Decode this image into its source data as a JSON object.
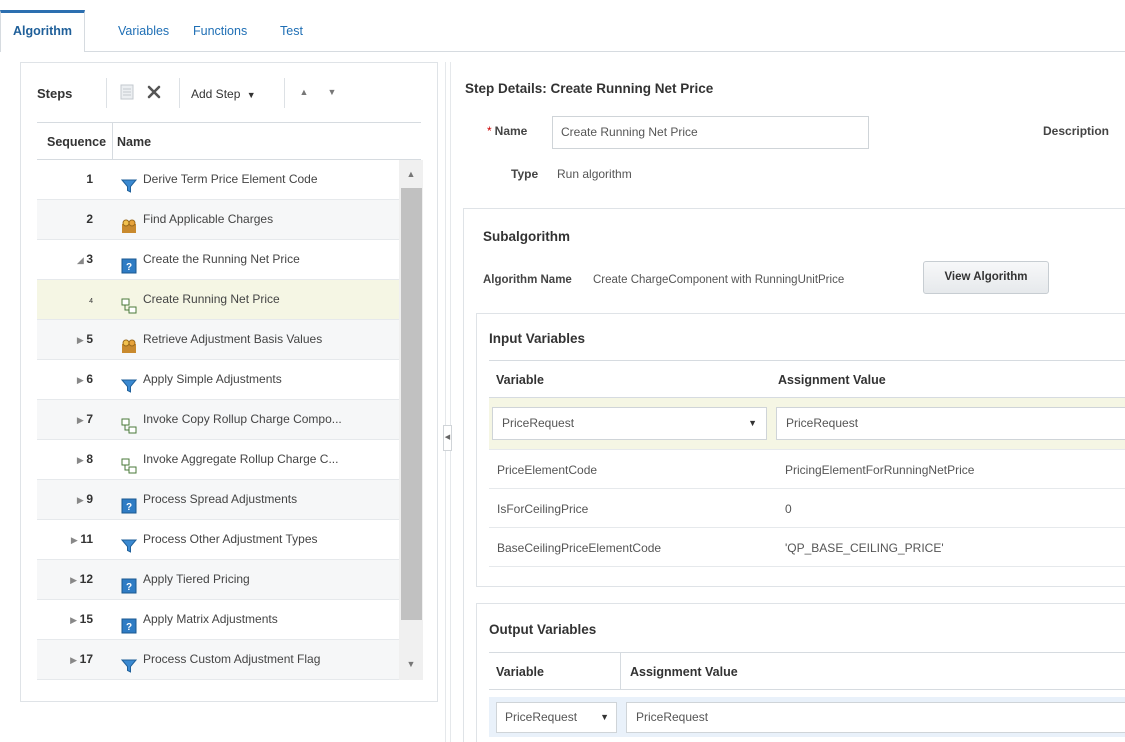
{
  "tabs": [
    {
      "label": "Algorithm",
      "active": true
    },
    {
      "label": "Variables",
      "active": false
    },
    {
      "label": "Functions",
      "active": false
    },
    {
      "label": "Test",
      "active": false
    }
  ],
  "steps": {
    "title": "Steps",
    "add_step_label": "Add Step",
    "columns": {
      "sequence": "Sequence",
      "name": "Name"
    },
    "rows": [
      {
        "seq": "1",
        "name": "Derive Term Price Element Code",
        "icon": "filter-icon",
        "expander": ""
      },
      {
        "seq": "2",
        "name": "Find Applicable Charges",
        "icon": "people-icon",
        "expander": ""
      },
      {
        "seq": "3",
        "name": "Create the Running Net Price",
        "icon": "help-book-icon",
        "expander": "◢"
      },
      {
        "seq": "4",
        "name": "Create Running Net Price",
        "icon": "subalgorithm-icon",
        "expander": ""
      },
      {
        "seq": "5",
        "name": "Retrieve Adjustment Basis Values",
        "icon": "people-icon",
        "expander": "▶"
      },
      {
        "seq": "6",
        "name": "Apply Simple Adjustments",
        "icon": "filter-icon",
        "expander": "▶"
      },
      {
        "seq": "7",
        "name": "Invoke Copy Rollup Charge Compo...",
        "icon": "subalgorithm-icon",
        "expander": "▶"
      },
      {
        "seq": "8",
        "name": "Invoke Aggregate Rollup Charge C...",
        "icon": "subalgorithm-icon",
        "expander": "▶"
      },
      {
        "seq": "9",
        "name": "Process Spread Adjustments",
        "icon": "help-book-icon",
        "expander": "▶"
      },
      {
        "seq": "11",
        "name": "Process Other Adjustment Types",
        "icon": "filter-icon",
        "expander": "▶"
      },
      {
        "seq": "12",
        "name": "Apply Tiered Pricing",
        "icon": "help-book-icon",
        "expander": "▶"
      },
      {
        "seq": "15",
        "name": "Apply Matrix Adjustments",
        "icon": "help-book-icon",
        "expander": "▶"
      },
      {
        "seq": "17",
        "name": "Process Custom Adjustment Flag",
        "icon": "filter-icon",
        "expander": "▶"
      }
    ]
  },
  "details": {
    "title": "Step Details: Create Running Net Price",
    "name_label": "Name",
    "name_value": "Create Running Net Price",
    "description_label": "Description",
    "type_label": "Type",
    "type_value": "Run algorithm"
  },
  "subalgorithm": {
    "title": "Subalgorithm",
    "algorithm_name_label": "Algorithm Name",
    "algorithm_name_value": "Create ChargeComponent with RunningUnitPrice",
    "view_button": "View Algorithm"
  },
  "input_variables": {
    "title": "Input Variables",
    "col_variable": "Variable",
    "col_value": "Assignment Value",
    "selected": {
      "variable": "PriceRequest",
      "value": "PriceRequest"
    },
    "rows": [
      {
        "variable": "PriceElementCode",
        "value": "PricingElementForRunningNetPrice"
      },
      {
        "variable": "IsForCeilingPrice",
        "value": "0"
      },
      {
        "variable": "BaseCeilingPriceElementCode",
        "value": "'QP_BASE_CEILING_PRICE'"
      }
    ]
  },
  "output_variables": {
    "title": "Output Variables",
    "col_variable": "Variable",
    "col_value": "Assignment Value",
    "selected": {
      "variable": "PriceRequest",
      "value": "PriceRequest"
    }
  }
}
